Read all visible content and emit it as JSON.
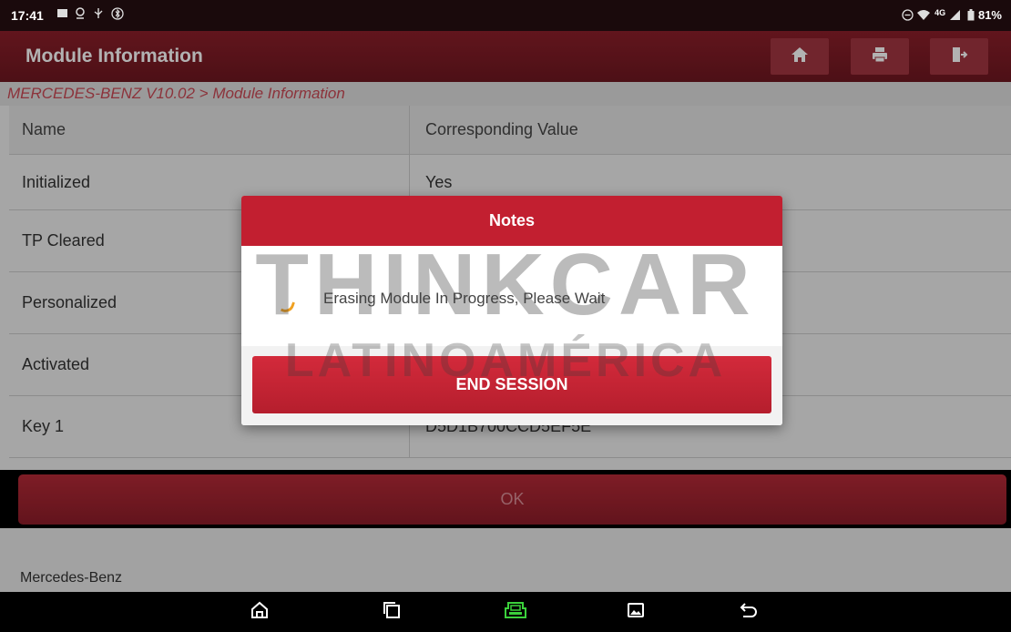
{
  "status_bar": {
    "time": "17:41",
    "network": "4G",
    "battery": "81%"
  },
  "header": {
    "title": "Module Information",
    "icons": [
      "home-icon",
      "print-icon",
      "exit-icon"
    ]
  },
  "breadcrumb": "MERCEDES-BENZ V10.02 > Module Information",
  "table": {
    "columns": [
      "Name",
      "Corresponding Value"
    ],
    "rows": [
      {
        "name": "Initialized",
        "value": "Yes"
      },
      {
        "name": "TP Cleared",
        "value": ""
      },
      {
        "name": "Personalized",
        "value": ""
      },
      {
        "name": "Activated",
        "value": ""
      },
      {
        "name": "Key 1",
        "value": "D5D1B700CCD5EF5E"
      }
    ]
  },
  "ok_button": "OK",
  "footer_brand": "Mercedes-Benz",
  "dialog": {
    "title": "Notes",
    "message": "Erasing Module In Progress, Please Wait",
    "button": "END SESSION"
  },
  "watermark": {
    "line1": "THINKCAR",
    "line2": "LATINOAMÉRICA"
  },
  "nav_bar": {
    "icons": [
      "home-icon",
      "recent-apps-icon",
      "vci-icon",
      "gallery-icon",
      "back-icon"
    ]
  },
  "colors": {
    "brand_red": "#8c1f2a",
    "dialog_red": "#c21f30",
    "breadcrumb_text": "#c94955",
    "vci_green": "#3bd13b"
  }
}
